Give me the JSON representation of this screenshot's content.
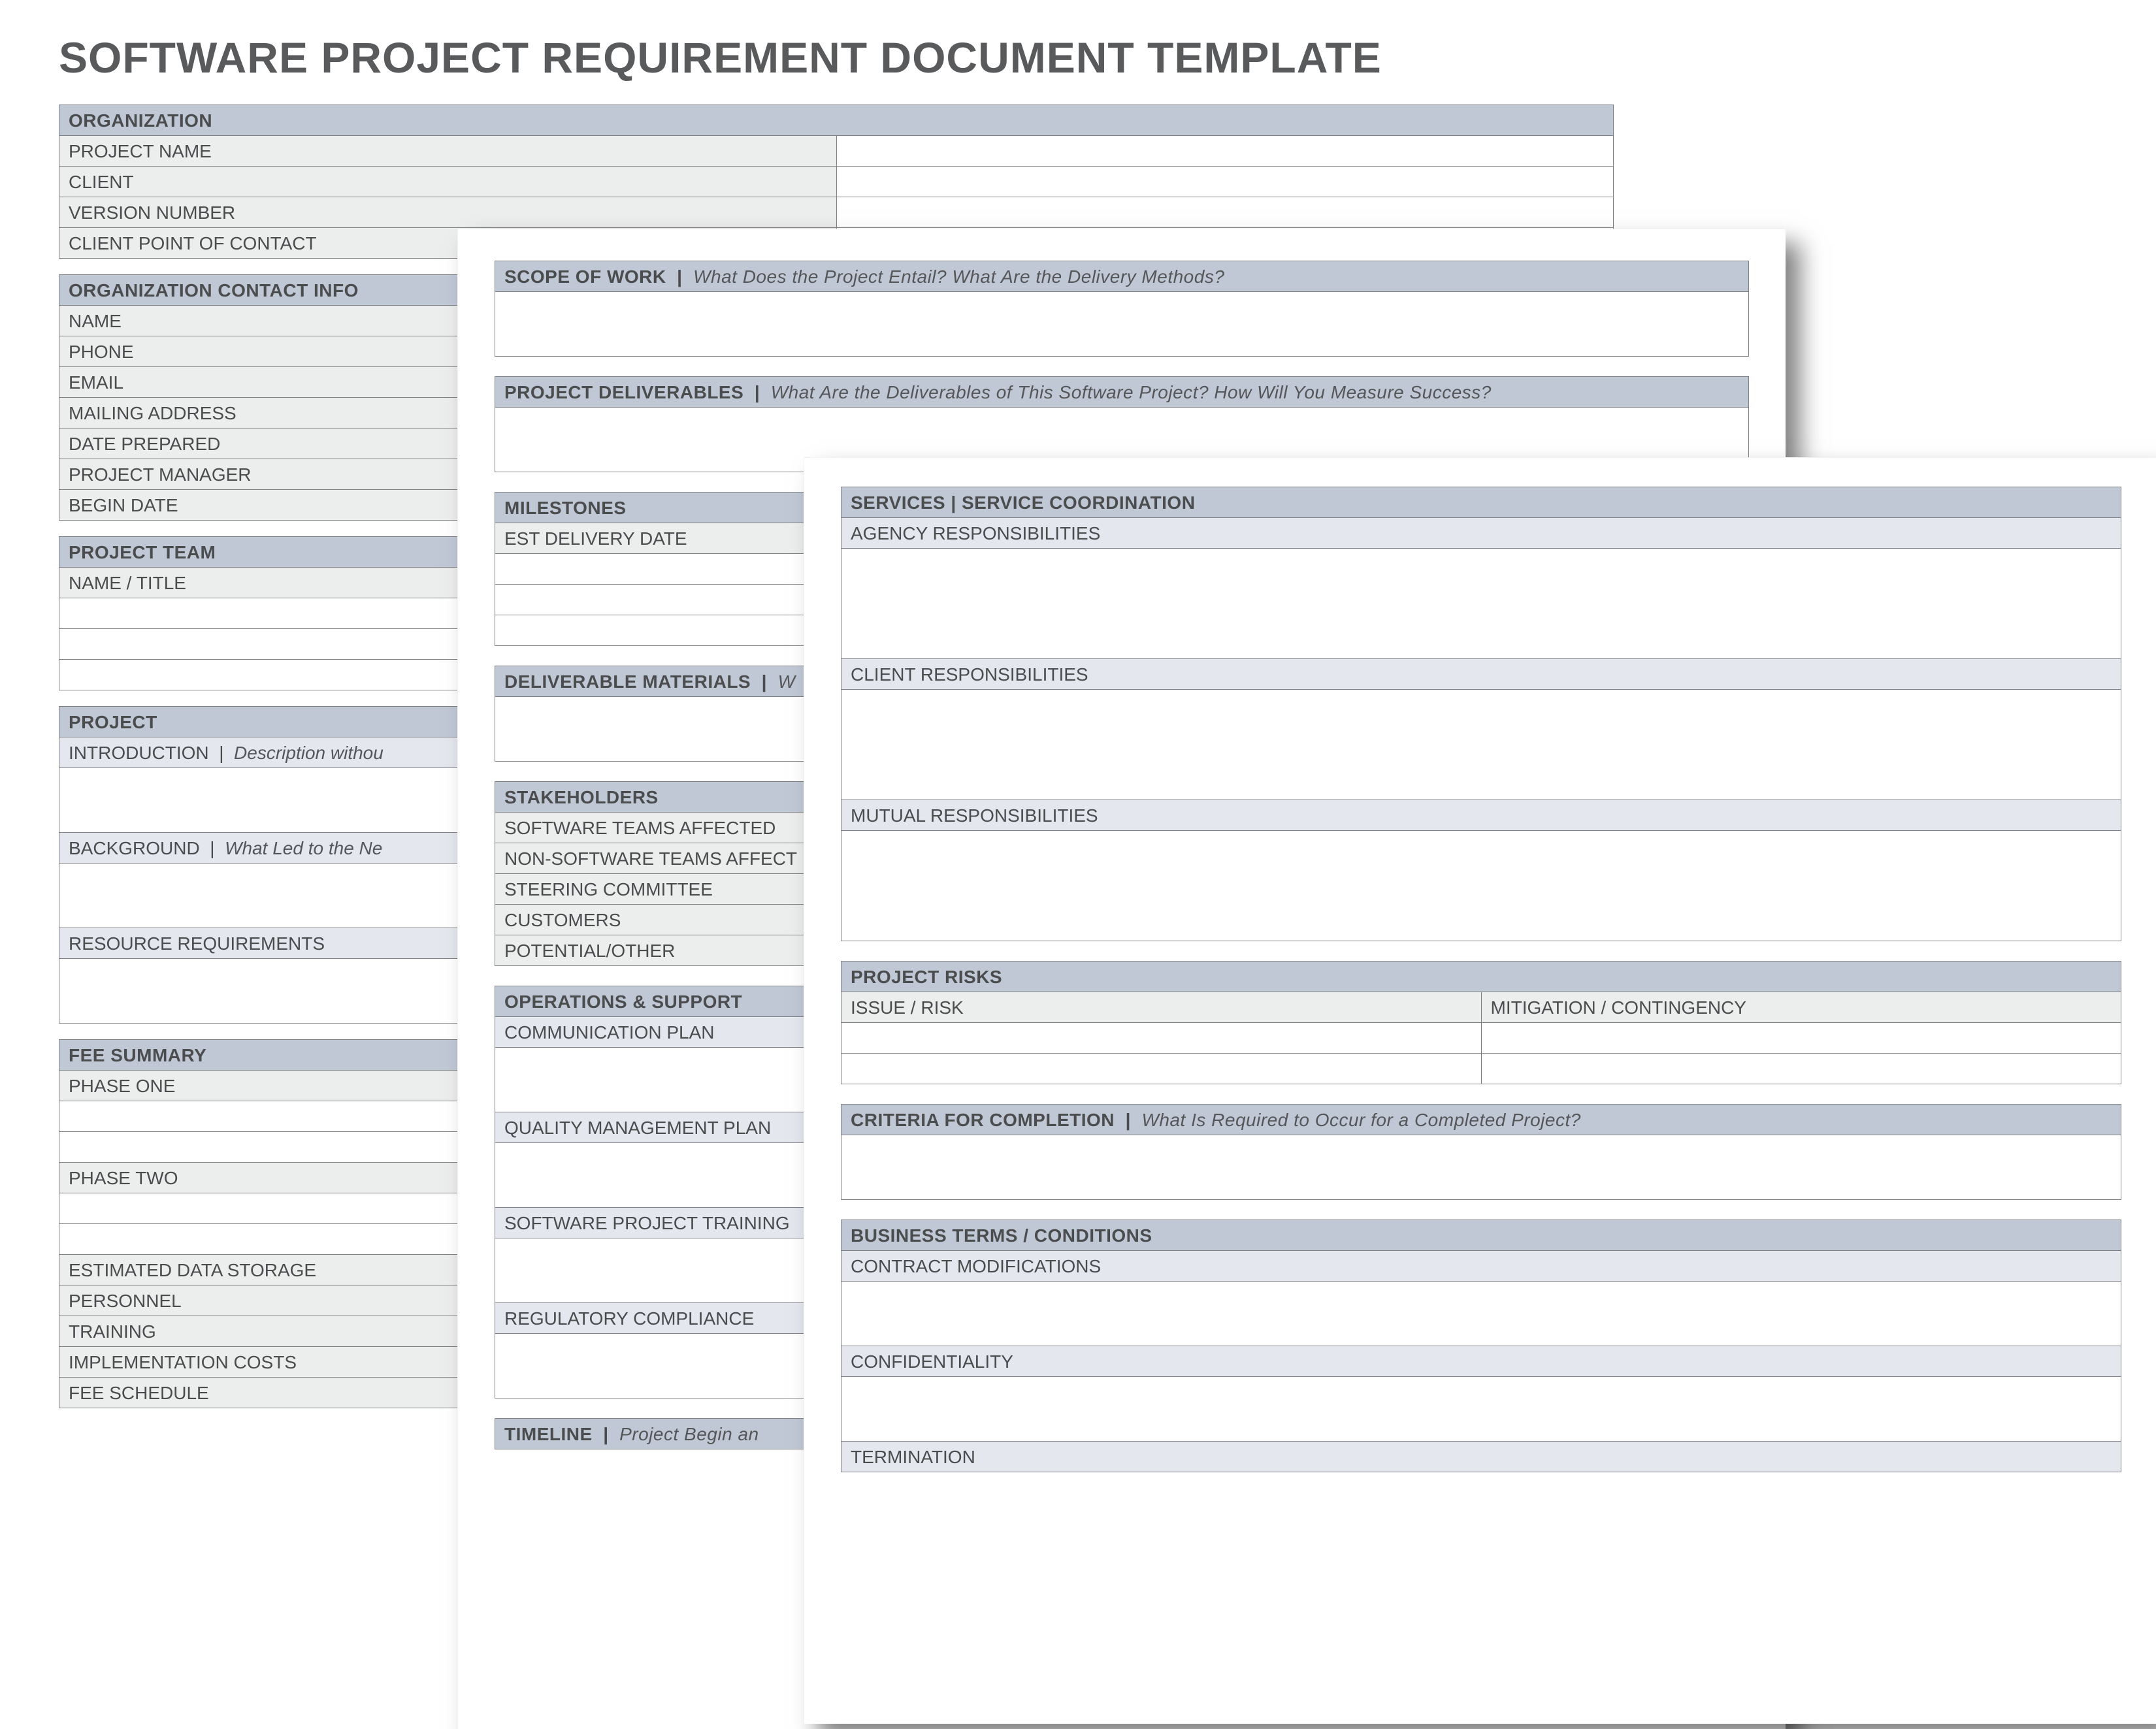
{
  "title": "SOFTWARE PROJECT REQUIREMENT DOCUMENT TEMPLATE",
  "a": {
    "organization": {
      "header": "ORGANIZATION",
      "rows": [
        "PROJECT NAME",
        "CLIENT",
        "VERSION NUMBER",
        "CLIENT POINT OF CONTACT"
      ]
    },
    "contact": {
      "header": "ORGANIZATION CONTACT INFO",
      "rows": [
        "NAME",
        "PHONE",
        "EMAIL",
        "MAILING ADDRESS",
        "DATE PREPARED",
        "PROJECT MANAGER",
        "BEGIN DATE"
      ]
    },
    "team": {
      "header": "PROJECT TEAM",
      "col": "NAME / TITLE"
    },
    "project": {
      "header": "PROJECT",
      "intro_lbl": "INTRODUCTION",
      "intro_hint": "Description withou",
      "bg_lbl": "BACKGROUND",
      "bg_hint": "What Led to the Ne",
      "res": "RESOURCE REQUIREMENTS"
    },
    "fee": {
      "header": "FEE SUMMARY",
      "p1": "PHASE ONE",
      "p2": "PHASE TWO",
      "rows": [
        "ESTIMATED DATA STORAGE",
        "PERSONNEL",
        "TRAINING",
        "IMPLEMENTATION COSTS",
        "FEE SCHEDULE"
      ]
    }
  },
  "b": {
    "scope": {
      "header": "SCOPE OF WORK",
      "hint": "What Does the Project Entail? What Are the Delivery Methods?"
    },
    "deliv": {
      "header": "PROJECT DELIVERABLES",
      "hint": "What Are the Deliverables of This Software Project? How Will You Measure Success?"
    },
    "milestones": {
      "header": "MILESTONES",
      "col": "EST DELIVERY DATE"
    },
    "materials": {
      "header": "DELIVERABLE MATERIALS",
      "hint": "W"
    },
    "stake": {
      "header": "STAKEHOLDERS",
      "rows": [
        "SOFTWARE TEAMS AFFECTED",
        "NON-SOFTWARE TEAMS AFFECT",
        "STEERING COMMITTEE",
        "CUSTOMERS",
        "POTENTIAL/OTHER"
      ]
    },
    "ops": {
      "header": "OPERATIONS & SUPPORT",
      "rows": [
        "COMMUNICATION PLAN",
        "QUALITY MANAGEMENT PLAN",
        "SOFTWARE PROJECT TRAINING",
        "REGULATORY COMPLIANCE"
      ]
    },
    "timeline": {
      "header": "TIMELINE",
      "hint": "Project Begin an"
    }
  },
  "c": {
    "services": {
      "header": "SERVICES | SERVICE COORDINATION",
      "rows": [
        "AGENCY RESPONSIBILITIES",
        "CLIENT RESPONSIBILITIES",
        "MUTUAL RESPONSIBILITIES"
      ]
    },
    "risks": {
      "header": "PROJECT RISKS",
      "c1": "ISSUE / RISK",
      "c2": "MITIGATION / CONTINGENCY"
    },
    "criteria": {
      "header": "CRITERIA FOR COMPLETION",
      "hint": "What Is Required to Occur for a Completed Project?"
    },
    "terms": {
      "header": "BUSINESS TERMS / CONDITIONS",
      "rows": [
        "CONTRACT MODIFICATIONS",
        "CONFIDENTIALITY",
        "TERMINATION"
      ]
    }
  }
}
